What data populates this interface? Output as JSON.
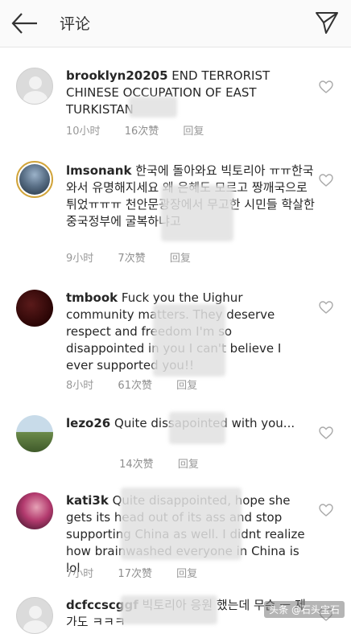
{
  "header": {
    "title": "评论",
    "back_icon": "back-arrow-icon",
    "send_icon": "direct-send-icon"
  },
  "comments": [
    {
      "username": "brooklyn20205",
      "text": "END TERRORIST CHINESE OCCUPATION OF EAST TURKISTAN",
      "time": "10小时",
      "likes": "16次赞",
      "reply": "回复"
    },
    {
      "username": "lmsonank",
      "text": "한국에 돌아와요 빅토리아 ㅠㅠ한국와서 유명해지세요 왜 은혜도 모르고 짱깨국으로 튀었ㅠㅠㅠ 천안문광장에서 무고한 시민들 학살한 중국정부에 굴복하냐고",
      "time": "9小时",
      "likes": "7次赞",
      "reply": "回复"
    },
    {
      "username": "tmbook",
      "text": "Fuck you the Uighur community matters. They deserve respect and freedom I'm so disappointed in you I can't believe I ever supported you!!",
      "time": "8小时",
      "likes": "61次赞",
      "reply": "回复"
    },
    {
      "username": "lezo26",
      "text": "Quite dissapointed with you...",
      "time": "",
      "likes": "14次赞",
      "reply": "回复"
    },
    {
      "username": "kati3k",
      "text": "Quite disappointed, hope she gets its head out of its ass and stop supporting China as well. I didnt realize how brainwashed everyone in China is lol",
      "time": "7小时",
      "likes": "17次赞",
      "reply": "回复"
    },
    {
      "username": "dcfccscggf",
      "text": "빅토리아 응원 했는데 무슨 ㅡ 제가도 ㅋㅋㅋ",
      "time": "",
      "likes": "",
      "reply": ""
    }
  ],
  "watermark": "头条 @石头宝石"
}
